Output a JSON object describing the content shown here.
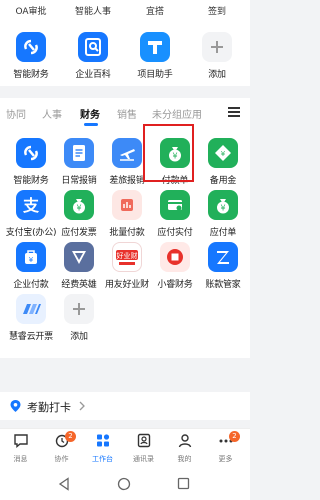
{
  "top_row": [
    "OA审批",
    "智能人事",
    "宜搭",
    "签到"
  ],
  "favorites": [
    {
      "label": "智能财务",
      "icon": "finance-icon"
    },
    {
      "label": "企业百科",
      "icon": "search-doc-icon"
    },
    {
      "label": "项目助手",
      "icon": "t-icon"
    },
    {
      "label": "添加",
      "icon": "plus-icon"
    }
  ],
  "tabs": [
    "协同",
    "人事",
    "财务",
    "销售",
    "未分组应用"
  ],
  "active_tab": "财务",
  "apps": [
    {
      "label": "智能财务",
      "icon": "finance-icon"
    },
    {
      "label": "日常报销",
      "icon": "doc-icon"
    },
    {
      "label": "差旅报销",
      "icon": "plane-icon"
    },
    {
      "label": "付款单",
      "icon": "money-bag-icon"
    },
    {
      "label": "备用金",
      "icon": "money-tag-icon"
    },
    {
      "label": "支付宝(办公)",
      "icon": "alipay-icon"
    },
    {
      "label": "应付发票",
      "icon": "money-bag-icon"
    },
    {
      "label": "批量付款",
      "icon": "batch-icon"
    },
    {
      "label": "应付实付",
      "icon": "card-icon"
    },
    {
      "label": "应付单",
      "icon": "money-bag-icon"
    },
    {
      "label": "企业付款",
      "icon": "bag-icon"
    },
    {
      "label": "经费英雄",
      "icon": "shield-icon"
    },
    {
      "label": "用友好业财",
      "icon": "yonyou-icon"
    },
    {
      "label": "小睿财务",
      "icon": "record-icon"
    },
    {
      "label": "账款管家",
      "icon": "z-icon"
    },
    {
      "label": "慧睿云开票",
      "icon": "cloud-icon"
    },
    {
      "label": "添加",
      "icon": "plus-icon"
    }
  ],
  "yonyou_logo": "好业财",
  "highlighted_app": "付款单",
  "attendance": {
    "label": "考勤打卡"
  },
  "nav": [
    {
      "label": "消息",
      "badge": ""
    },
    {
      "label": "协作",
      "badge": "2"
    },
    {
      "label": "工作台",
      "badge": ""
    },
    {
      "label": "通讯录",
      "badge": ""
    },
    {
      "label": "我的",
      "badge": ""
    },
    {
      "label": "更多",
      "badge": "2"
    }
  ],
  "colors": {
    "primary": "#1677ff",
    "green": "#21b05a",
    "highlight": "#e02020",
    "badge": "#f5662a"
  }
}
